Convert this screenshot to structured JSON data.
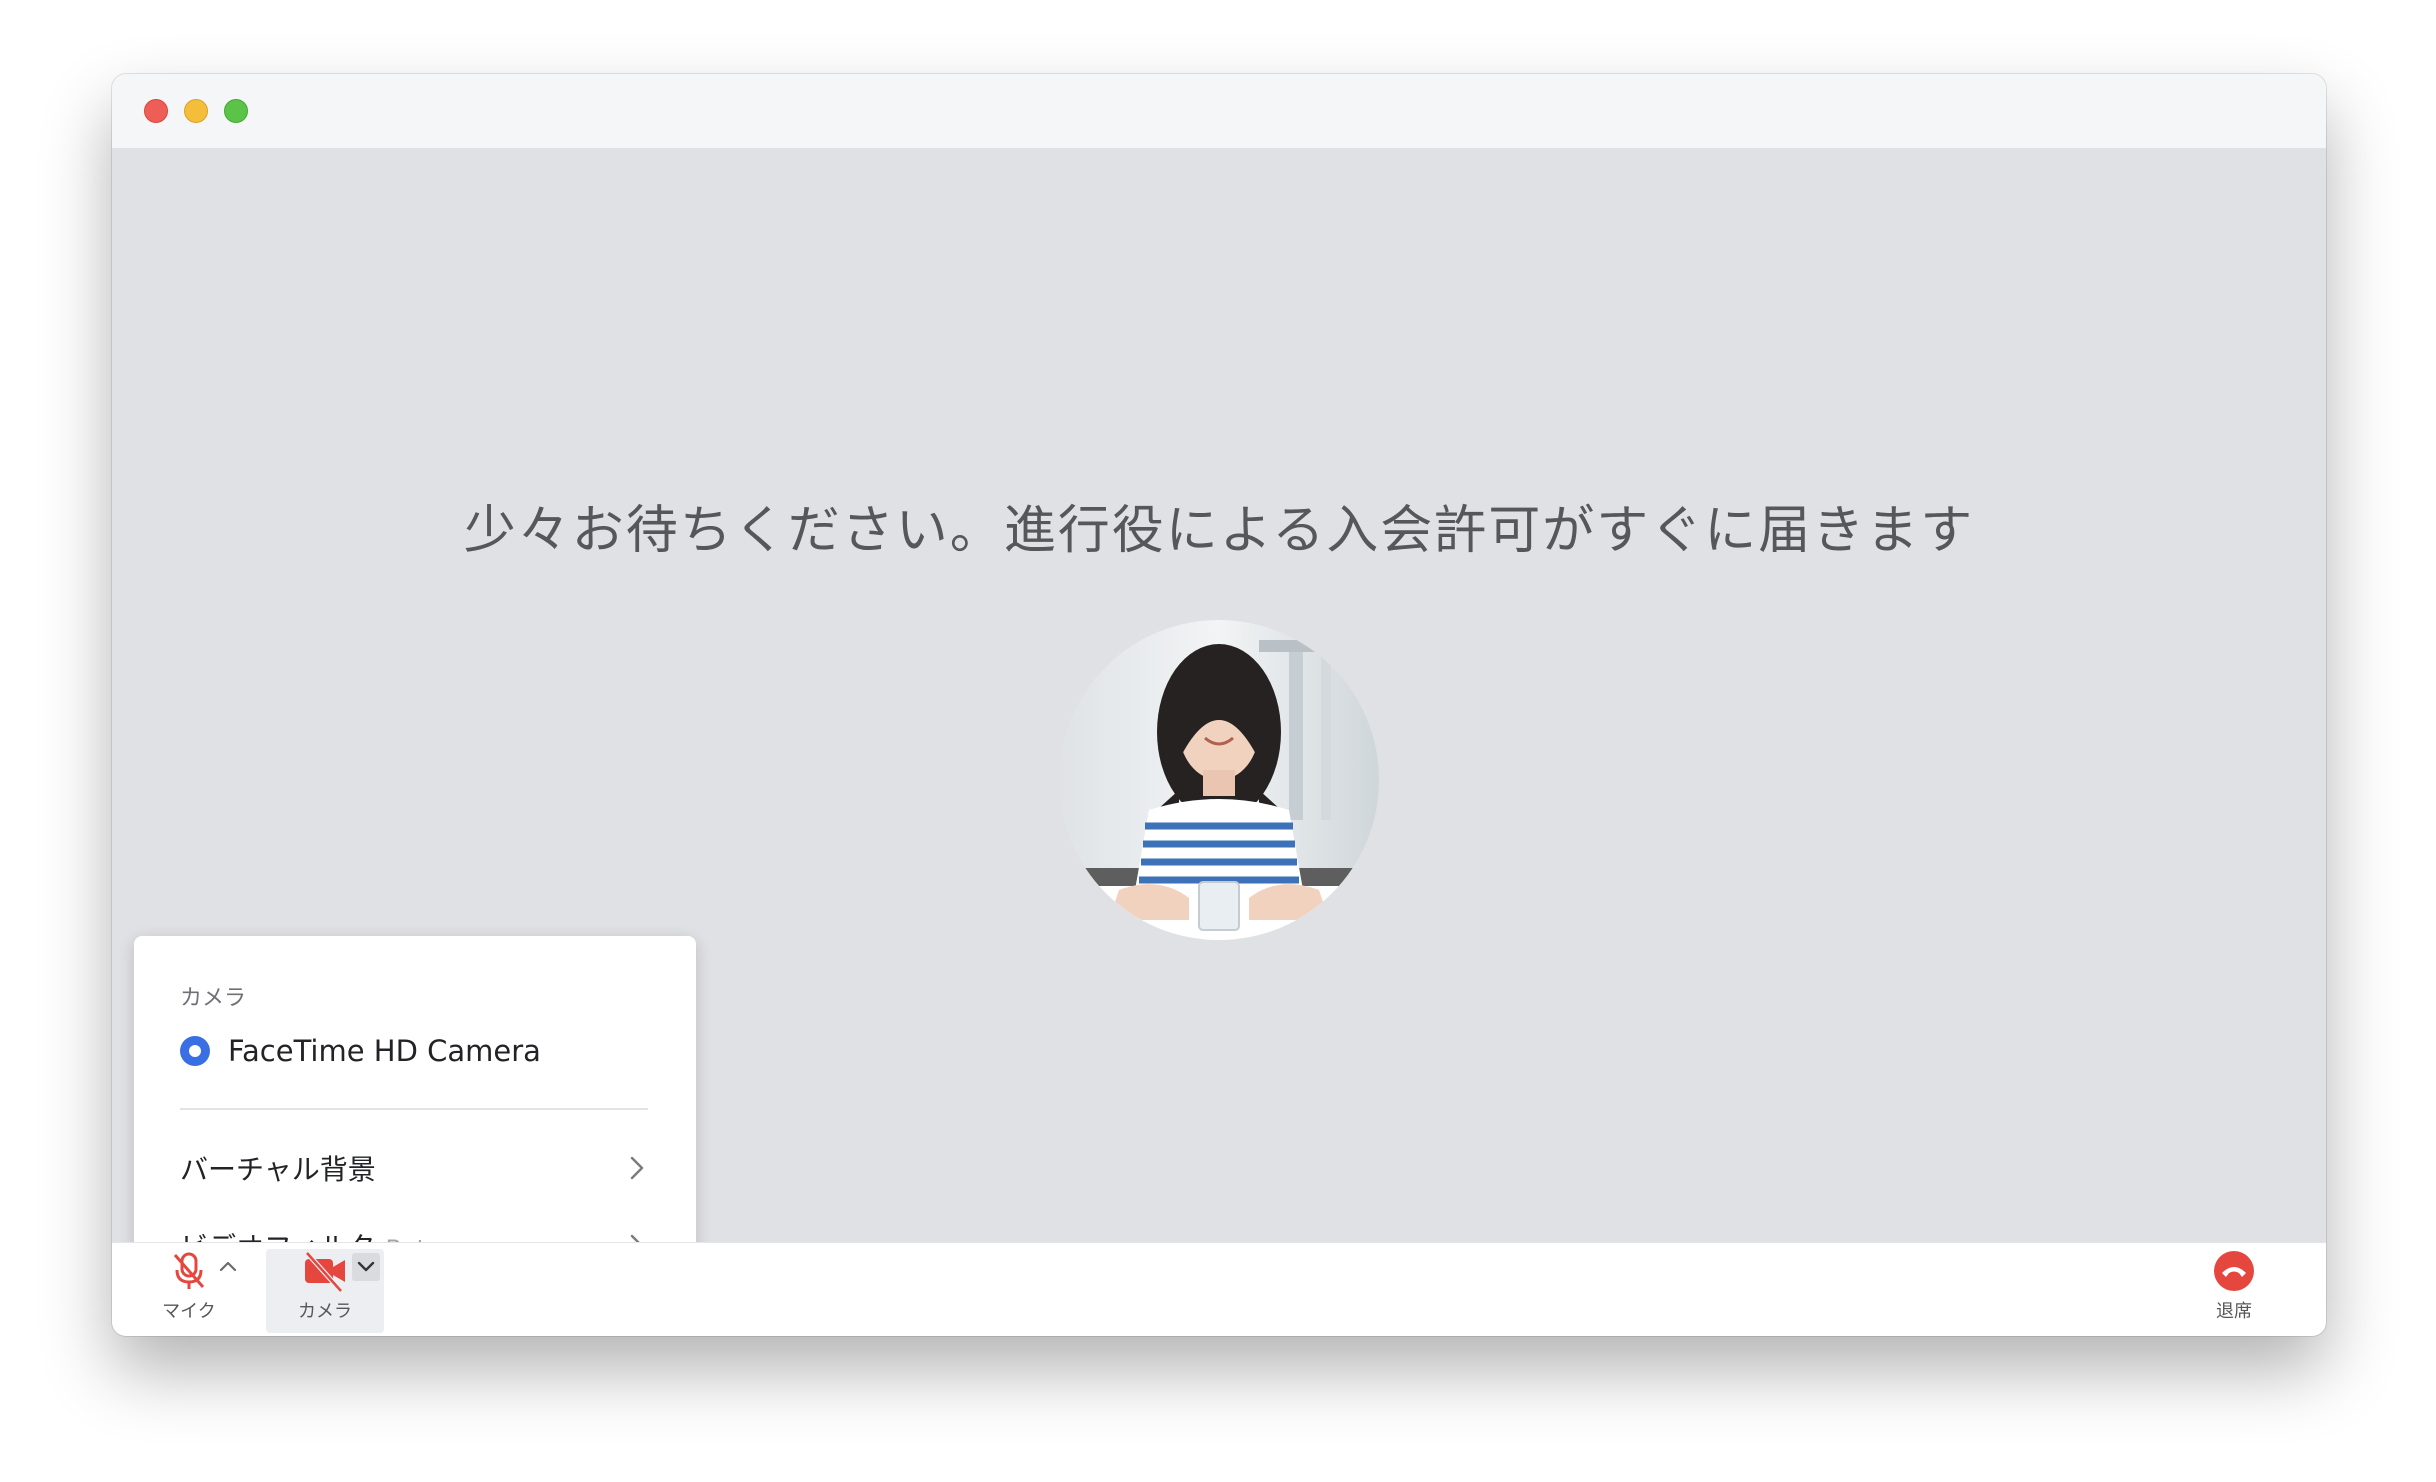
{
  "waiting": {
    "message": "少々お待ちください。進行役による入会許可がすぐに届きます"
  },
  "camera_menu": {
    "section_label": "カメラ",
    "selected_camera": "FaceTime HD Camera",
    "items": [
      {
        "label": "バーチャル背景"
      },
      {
        "label": "ビデオフィルタ",
        "badge": "Beta"
      }
    ]
  },
  "toolbar": {
    "mic_label": "マイク",
    "camera_label": "カメラ",
    "leave_label": "退席"
  },
  "colors": {
    "accent": "#3a6fe4",
    "danger": "#e5473f",
    "stage_bg": "#e0e1e5"
  },
  "icons": {
    "mic": "mic-off-icon",
    "camera": "camera-off-icon",
    "leave": "phone-hangup-icon",
    "chevron": "chevron-right-icon"
  }
}
